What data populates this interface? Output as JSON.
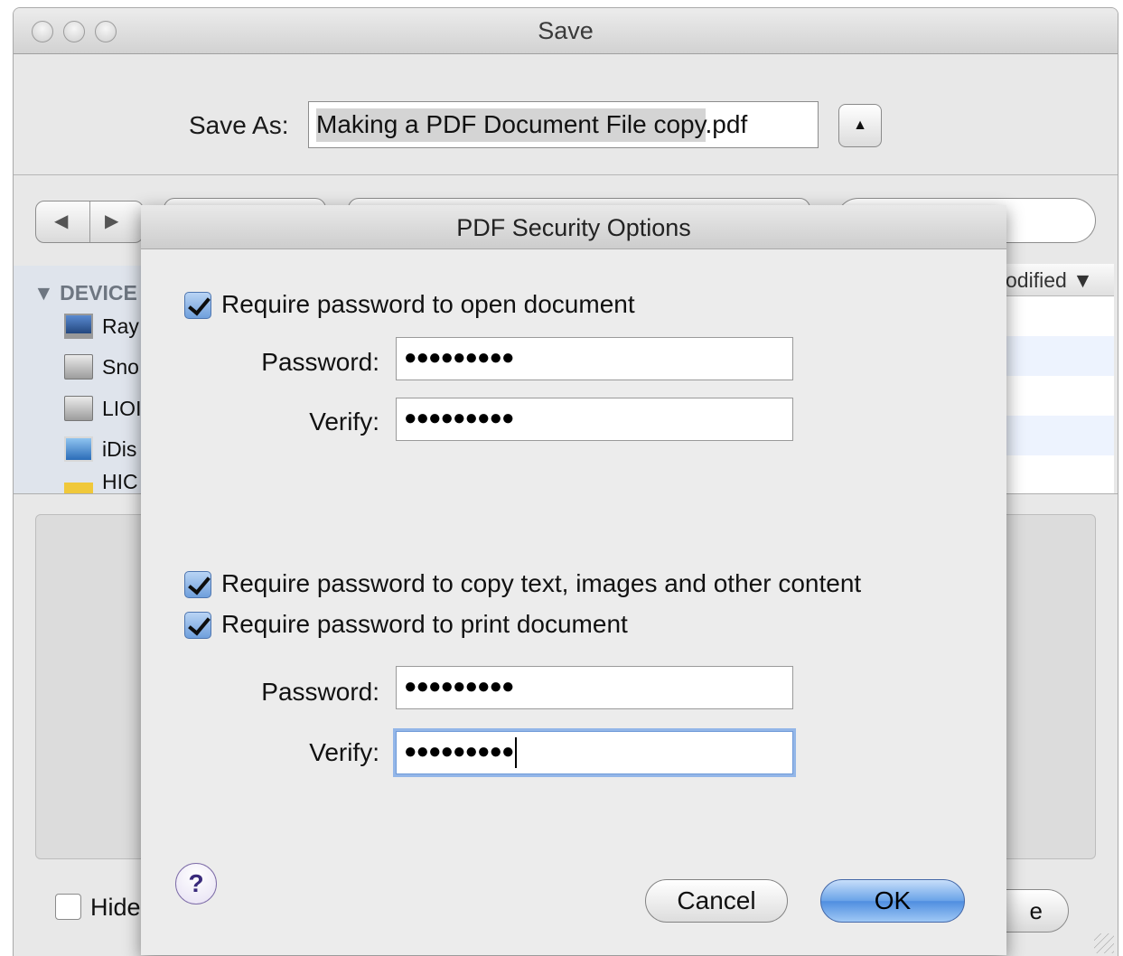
{
  "window": {
    "title": "Save",
    "buttons": [
      "close",
      "minimize",
      "zoom"
    ]
  },
  "save_as": {
    "label": "Save As:",
    "filename_selected": "Making a PDF Document File copy",
    "filename_extension": ".pdf",
    "expand_icon": "triangle-up-icon",
    "expand_glyph": "▲"
  },
  "navigation": {
    "back_glyph": "◀",
    "forward_glyph": "▶"
  },
  "sidebar": {
    "section_label": "▼ DEVICE",
    "items": [
      {
        "label": "Ray",
        "icon": "imac-icon"
      },
      {
        "label": "Sno",
        "icon": "hard-drive-icon"
      },
      {
        "label": "LIOI",
        "icon": "hard-drive-icon"
      },
      {
        "label": "iDis",
        "icon": "idisk-icon"
      },
      {
        "label": "HIC",
        "icon": "folder-icon"
      }
    ]
  },
  "file_list": {
    "column_header": "odified ▼"
  },
  "bottom_bar": {
    "hide_extension_label": "Hide",
    "save_button_label": "e"
  },
  "sheet": {
    "title": "PDF Security Options",
    "open_password": {
      "checkbox_label": "Require password to open document",
      "checked": true,
      "password_label": "Password:",
      "password_value": "●●●●●●●●●",
      "verify_label": "Verify:",
      "verify_value": "●●●●●●●●●"
    },
    "permissions": {
      "copy_checkbox_label": "Require password to copy text, images and other content",
      "copy_checked": true,
      "print_checkbox_label": "Require password to print document",
      "print_checked": true,
      "password_label": "Password:",
      "password_value": "●●●●●●●●●",
      "verify_label": "Verify:",
      "verify_value": "●●●●●●●●●"
    },
    "help_glyph": "?",
    "cancel_label": "Cancel",
    "ok_label": "OK"
  },
  "colors": {
    "accent_blue": "#6aa3e8",
    "window_bg": "#e8e8e8",
    "sidebar_bg": "#dfe4ec",
    "help_purple": "#7f6ea9"
  }
}
